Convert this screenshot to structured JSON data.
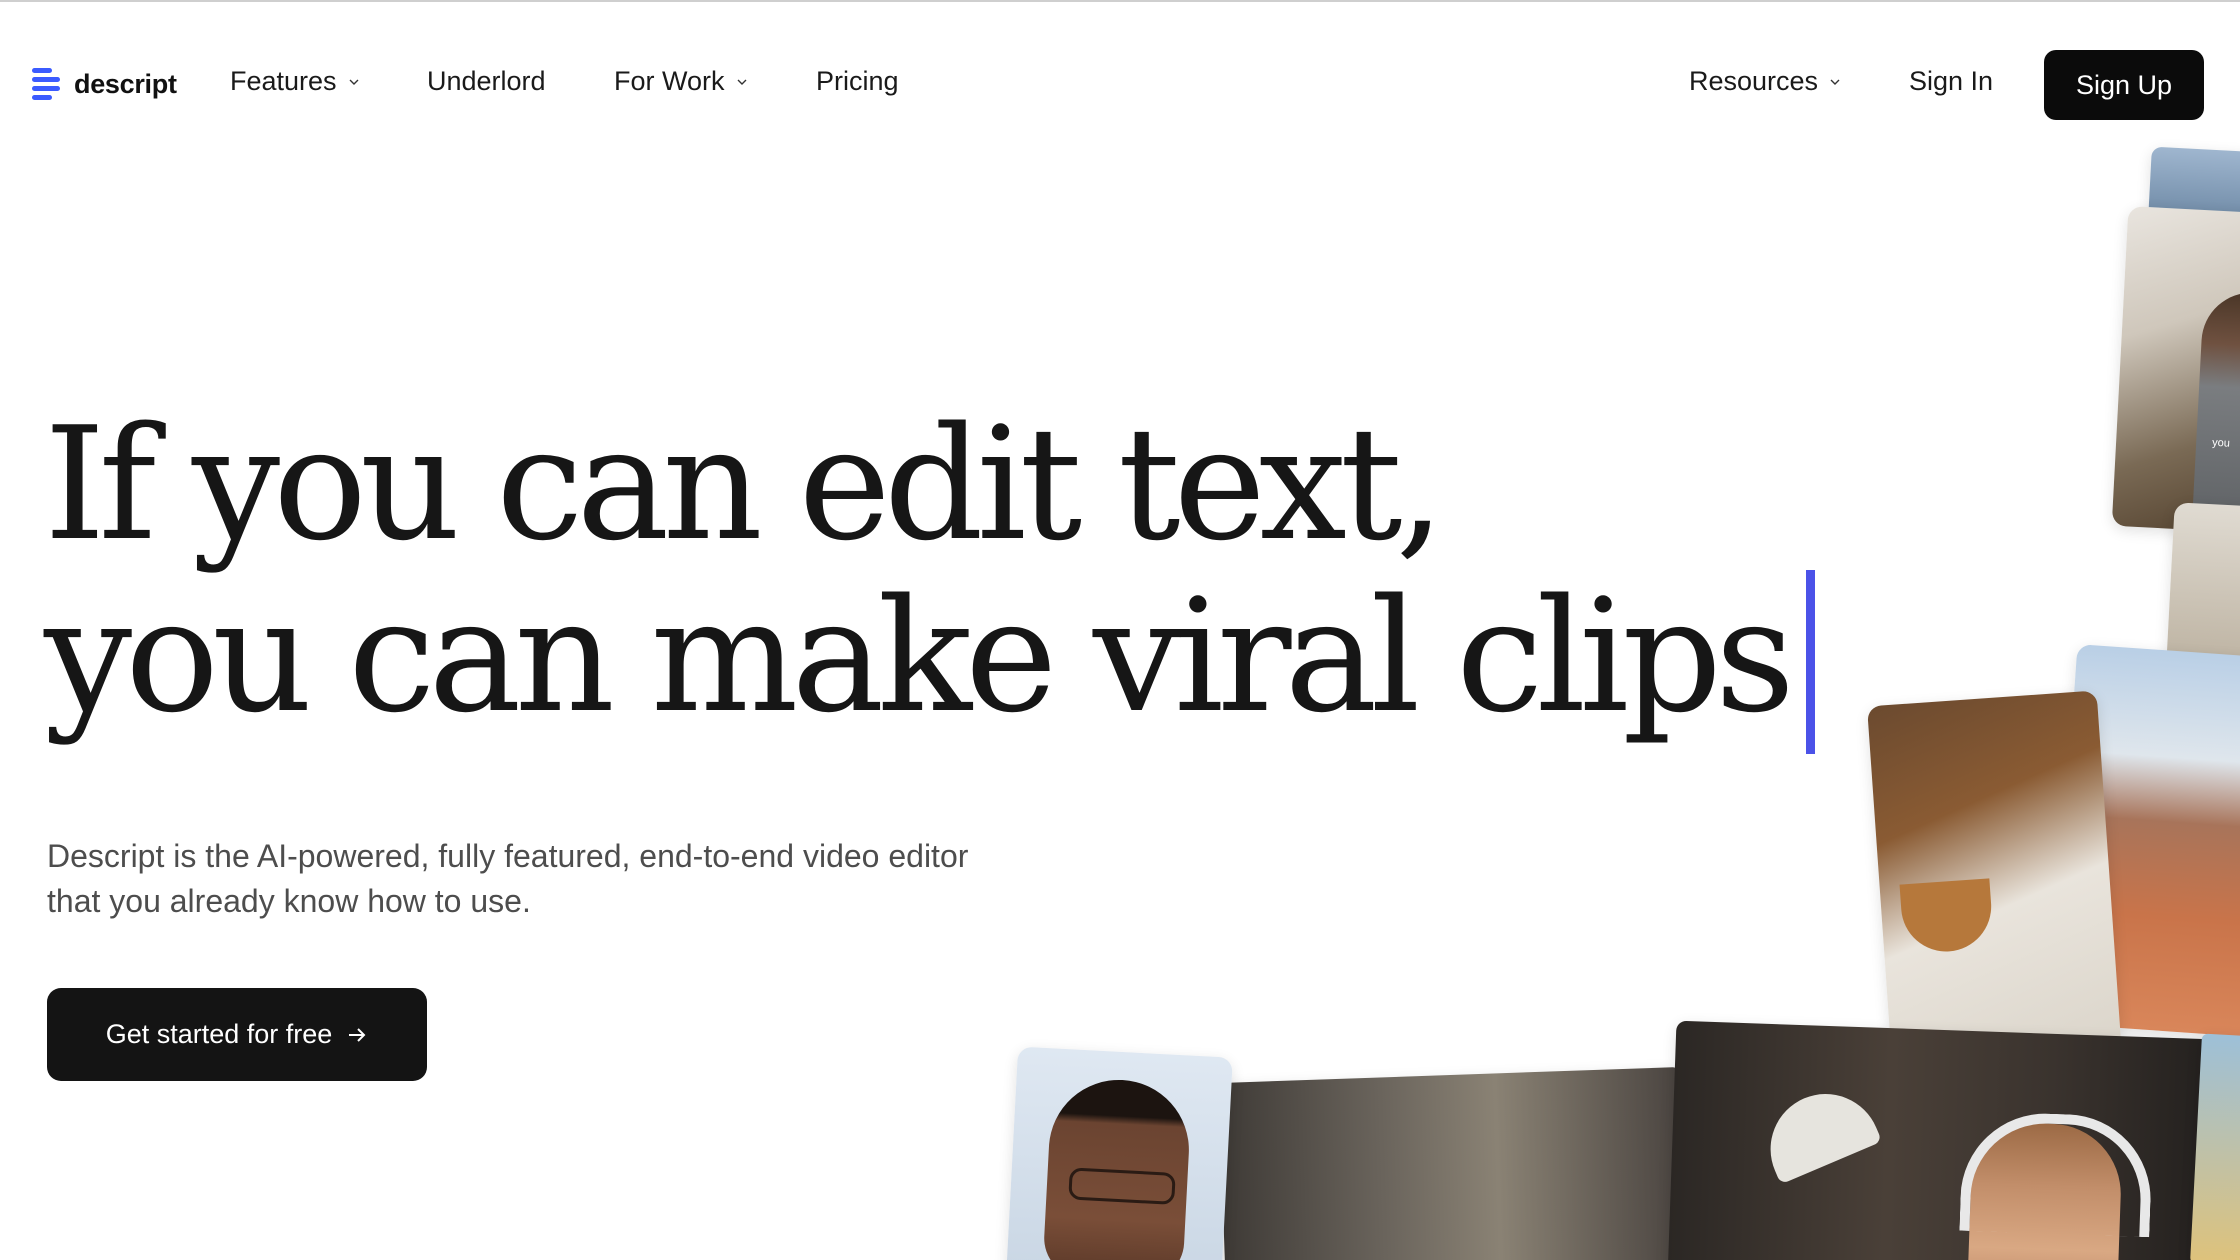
{
  "nav": {
    "logo_text": "descript",
    "items": [
      {
        "label": "Features",
        "has_dropdown": true
      },
      {
        "label": "Underlord",
        "has_dropdown": false
      },
      {
        "label": "For Work",
        "has_dropdown": true
      },
      {
        "label": "Pricing",
        "has_dropdown": false
      }
    ],
    "right_items": [
      {
        "label": "Resources",
        "has_dropdown": true
      },
      {
        "label": "Sign In",
        "has_dropdown": false
      }
    ],
    "signup_label": "Sign Up"
  },
  "hero": {
    "headline_line1": "If you can edit text,",
    "headline_line2": "you can make viral clips",
    "subtext_line1": "Descript is the AI-powered, fully featured, end-to-end video editor",
    "subtext_line2": "that you already know how to use.",
    "cta_label": "Get started for free",
    "cta_icon": "arrow-right-icon"
  },
  "collage": {
    "shirt_text": "you"
  },
  "colors": {
    "brand_blue": "#3b5bff",
    "caret": "#4b52e8",
    "button_bg": "#0b0b0b",
    "text_muted": "#4d4d4d"
  }
}
